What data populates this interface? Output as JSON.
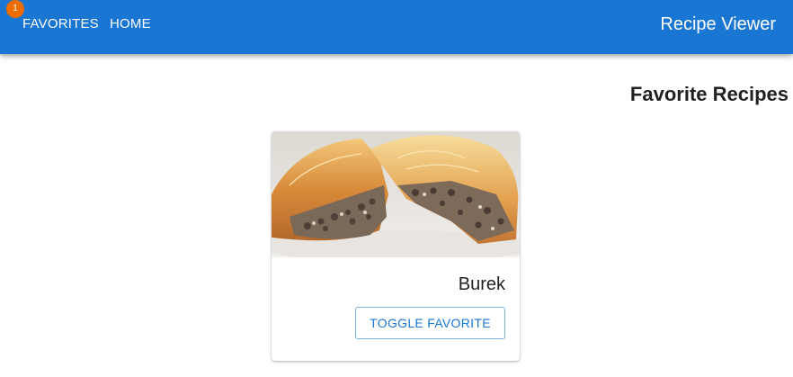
{
  "appbar": {
    "favorites_label": "FAVORITES",
    "favorites_count": "1",
    "home_label": "HOME",
    "title": "Recipe Viewer",
    "background_color": "#1976d2",
    "badge_color": "#ef6c00"
  },
  "main": {
    "heading": "Favorite Recipes",
    "recipes": [
      {
        "name": "Burek",
        "button_label": "TOGGLE FAVORITE",
        "image_alt": "burek-photo"
      }
    ]
  }
}
